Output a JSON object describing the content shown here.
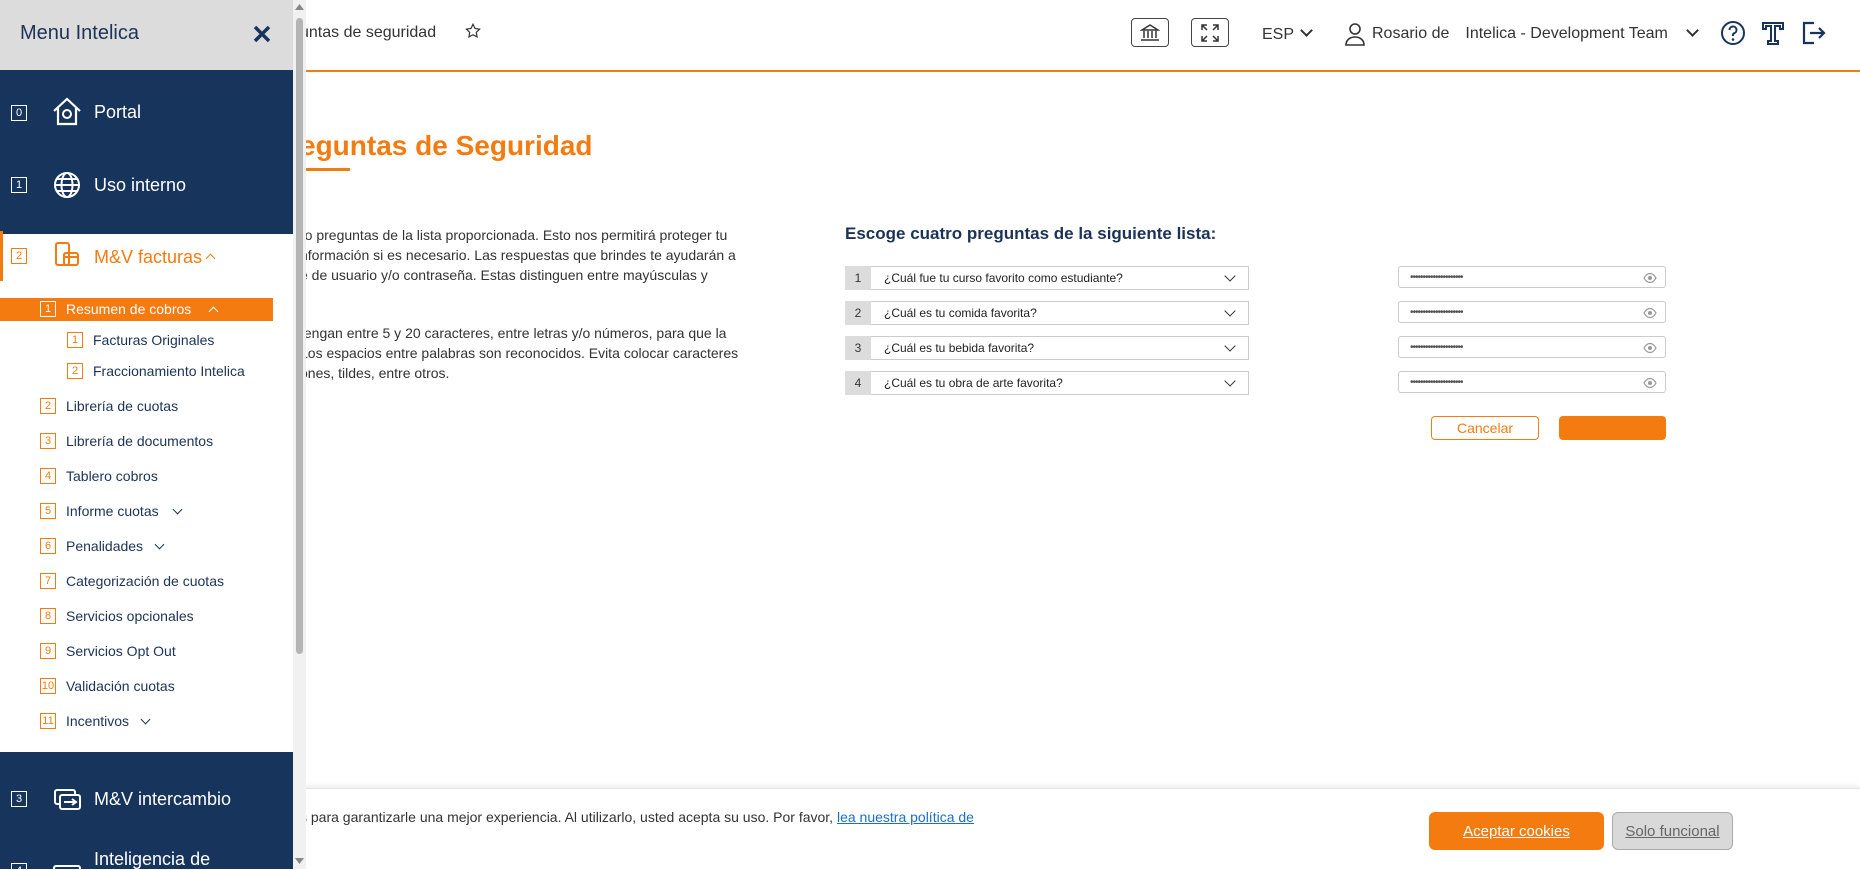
{
  "header": {
    "breadcrumb": "untas de seguridad",
    "language": "ESP",
    "user_name": "Rosario de",
    "team": "Intelica - Development Team",
    "icons": [
      "star-icon",
      "bank-icon",
      "fullscreen-icon",
      "user-icon",
      "help-icon",
      "text-size-icon",
      "logout-icon"
    ]
  },
  "main": {
    "title": "eguntas de Seguridad",
    "paragraph1": [
      "ro preguntas de la lista proporcionada. Esto nos permitirá proteger tu",
      "nformación si es necesario. Las respuestas que brindes te ayudarán a",
      "e de usuario y/o contraseña. Estas distinguen entre mayúsculas y"
    ],
    "paragraph2": [
      "tengan entre 5 y 20 caracteres, entre letras y/o números, para que la",
      "Los espacios entre palabras son reconocidos. Evita colocar caracteres",
      "ones, tildes, entre otros."
    ],
    "questions_heading": "Escoge cuatro preguntas de la siguiente lista:",
    "questions": [
      {
        "num": "1",
        "question": "¿Cuál fue tu curso favorito como estudiante?",
        "answer": "•••••••••••••••••••••"
      },
      {
        "num": "2",
        "question": "¿Cuál es tu comida favorita?",
        "answer": "•••••••••••••••••••••"
      },
      {
        "num": "3",
        "question": "¿Cuál es tu bebida favorita?",
        "answer": "•••••••••••••••••••••"
      },
      {
        "num": "4",
        "question": "¿Cuál es tu obra de arte favorita?",
        "answer": "•••••••••••••••••••••"
      }
    ],
    "cancel_label": "Cancelar",
    "save_label": ""
  },
  "cookie": {
    "text": "s para garantizarle una mejor experiencia. Al utilizarlo, usted acepta su uso. Por favor, ",
    "link": "lea nuestra política de",
    "accept_label": "Aceptar cookies",
    "functional_label": "Solo funcional"
  },
  "sidebar": {
    "title": "Menu Intelica",
    "items": [
      {
        "num": "0",
        "label": "Portal",
        "icon": "home-icon"
      },
      {
        "num": "1",
        "label": "Uso interno",
        "icon": "globe-icon"
      },
      {
        "num": "2",
        "label": "M&V facturas",
        "icon": "phone-card-icon"
      },
      {
        "num": "3",
        "label": "M&V intercambio",
        "icon": "exchange-icon"
      },
      {
        "num": "4",
        "label": "Inteligencia de",
        "icon": "intelligence-icon"
      }
    ],
    "subitems": [
      {
        "num": "1",
        "label": "Resumen de cobros"
      },
      {
        "num": "1",
        "label": "Facturas Originales"
      },
      {
        "num": "2",
        "label": "Fraccionamiento Intelica"
      },
      {
        "num": "2",
        "label": "Librería de cuotas"
      },
      {
        "num": "3",
        "label": "Librería de documentos"
      },
      {
        "num": "4",
        "label": "Tablero cobros"
      },
      {
        "num": "5",
        "label": "Informe cuotas"
      },
      {
        "num": "6",
        "label": "Penalidades"
      },
      {
        "num": "7",
        "label": "Categorización de cuotas"
      },
      {
        "num": "8",
        "label": "Servicios opcionales"
      },
      {
        "num": "9",
        "label": "Servicios Opt Out"
      },
      {
        "num": "10",
        "label": "Validación cuotas"
      },
      {
        "num": "11",
        "label": "Incentivos"
      }
    ]
  },
  "colors": {
    "accent": "#f47b0f",
    "navy": "#17345c"
  }
}
